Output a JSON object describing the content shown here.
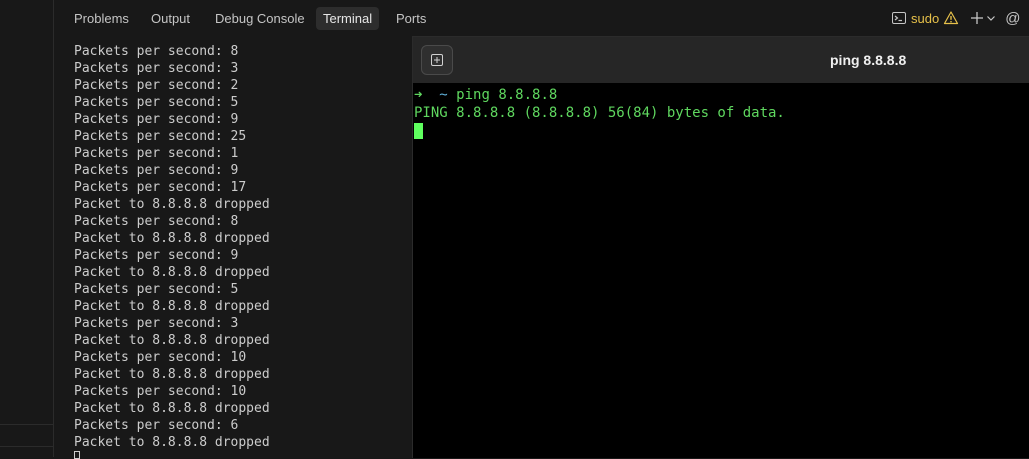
{
  "tabs": [
    {
      "label": "Problems"
    },
    {
      "label": "Output"
    },
    {
      "label": "Debug Console"
    },
    {
      "label": "Terminal",
      "active": true
    },
    {
      "label": "Ports"
    }
  ],
  "toolbar": {
    "terminal_profile_label": "sudo",
    "icons": [
      "terminal-icon",
      "warning-icon",
      "plus-icon",
      "chevron-down-icon",
      "at-icon"
    ]
  },
  "output_log": [
    "Packets per second: 8",
    "Packets per second: 3",
    "Packets per second: 2",
    "Packets per second: 5",
    "Packets per second: 9",
    "Packets per second: 25",
    "Packets per second: 1",
    "Packets per second: 9",
    "Packets per second: 17",
    "Packet to 8.8.8.8 dropped",
    "Packets per second: 8",
    "Packet to 8.8.8.8 dropped",
    "Packets per second: 9",
    "Packet to 8.8.8.8 dropped",
    "Packets per second: 5",
    "Packet to 8.8.8.8 dropped",
    "Packets per second: 3",
    "Packet to 8.8.8.8 dropped",
    "Packets per second: 10",
    "Packet to 8.8.8.8 dropped",
    "Packets per second: 10",
    "Packet to 8.8.8.8 dropped",
    "Packets per second: 6",
    "Packet to 8.8.8.8 dropped"
  ],
  "terminal": {
    "title": "ping 8.8.8.8",
    "prompt_arrow": "➜",
    "prompt_dir": "~",
    "command": "ping 8.8.8.8",
    "output": "PING 8.8.8.8 (8.8.8.8) 56(84) bytes of data."
  },
  "colors": {
    "background": "#181818",
    "terminal_bg": "#000000",
    "prompt_green": "#5fd75f",
    "warning": "#e6c04a"
  }
}
